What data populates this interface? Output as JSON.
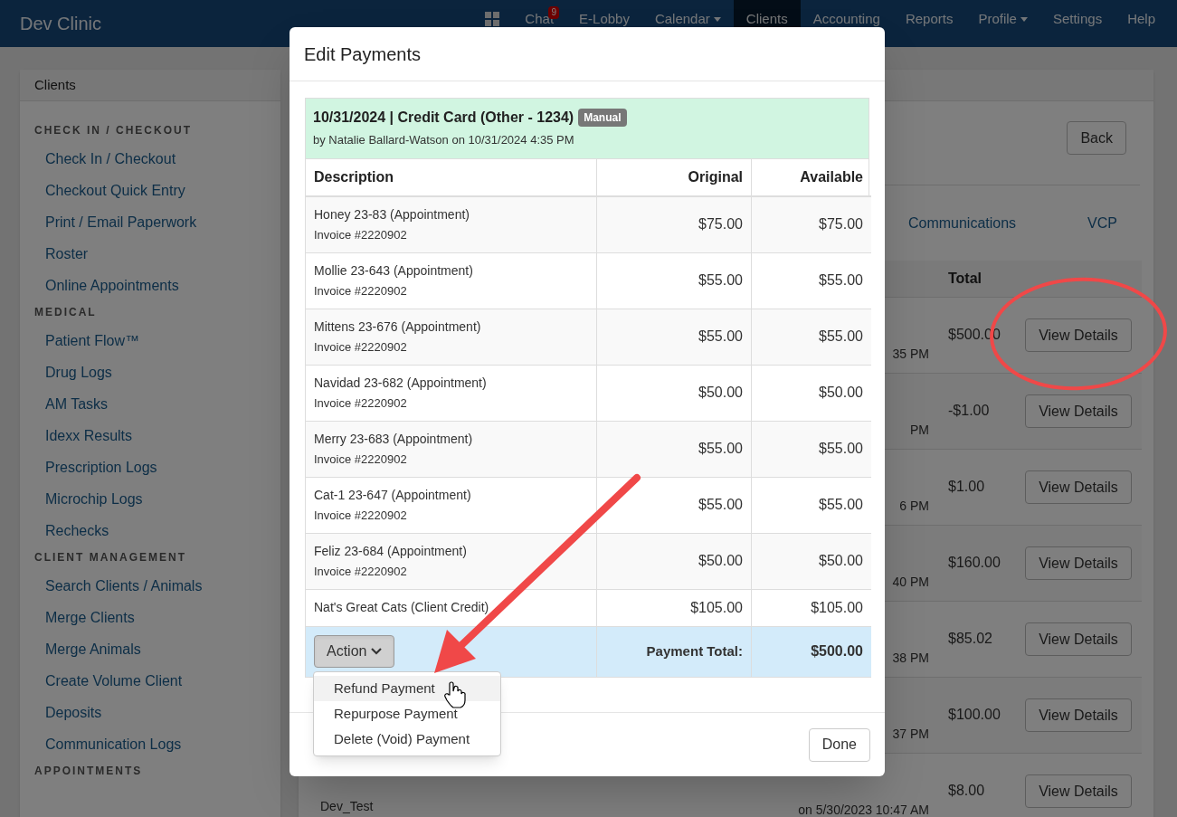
{
  "brand": "Dev Clinic",
  "nav": [
    {
      "kind": "grid",
      "selected": false
    },
    {
      "kind": "link",
      "label": "Chat",
      "badge": "9",
      "selected": false
    },
    {
      "kind": "link",
      "label": "E-Lobby",
      "selected": false
    },
    {
      "kind": "dropdown",
      "label": "Calendar",
      "selected": false
    },
    {
      "kind": "link",
      "label": "Clients",
      "selected": true
    },
    {
      "kind": "link",
      "label": "Accounting",
      "selected": false
    },
    {
      "kind": "link",
      "label": "Reports",
      "selected": false
    },
    {
      "kind": "dropdown",
      "label": "Profile",
      "selected": false
    },
    {
      "kind": "link",
      "label": "Settings",
      "selected": false
    },
    {
      "kind": "link",
      "label": "Help",
      "selected": false
    }
  ],
  "sidebar": {
    "title": "Clients",
    "sections": [
      {
        "heading": "CHECK IN / CHECKOUT",
        "items": [
          "Check In / Checkout",
          "Checkout Quick Entry",
          "Print / Email Paperwork",
          "Roster",
          "Online Appointments"
        ]
      },
      {
        "heading": "MEDICAL",
        "items": [
          "Patient Flow™",
          "Drug Logs",
          "AM Tasks",
          "Idexx Results",
          "Prescription Logs",
          "Microchip Logs",
          "Rechecks"
        ]
      },
      {
        "heading": "CLIENT MANAGEMENT",
        "items": [
          "Search Clients / Animals",
          "Merge Clients",
          "Merge Animals",
          "Create Volume Client",
          "Deposits",
          "Communication Logs"
        ]
      },
      {
        "heading": "APPOINTMENTS"
      }
    ]
  },
  "main": {
    "back_button": "Back",
    "tabs": [
      "Communications",
      "VCP"
    ],
    "total_column": "Total",
    "rows": [
      {
        "time": "35 PM",
        "total": "$500.00",
        "button": "View Details"
      },
      {
        "time": "PM",
        "total": "-$1.00",
        "button": "View Details"
      },
      {
        "time": "6 PM",
        "total": "$1.00",
        "button": "View Details"
      },
      {
        "time": "40 PM",
        "total": "$160.00",
        "button": "View Details"
      },
      {
        "time": "38 PM",
        "total": "$85.02",
        "button": "View Details"
      },
      {
        "time": "37 PM",
        "total": "$100.00",
        "button": "View Details"
      },
      {
        "name": "Dev_Test",
        "time": "on 5/30/2023 10:47 AM",
        "total": "$8.00",
        "button": "View Details"
      }
    ]
  },
  "modal": {
    "title": "Edit Payments",
    "payment": {
      "heading": "10/31/2024 | Credit Card (Other - 1234)",
      "badge": "Manual",
      "byline": "by Natalie Ballard-Watson on 10/31/2024 4:35 PM"
    },
    "columns": [
      "Description",
      "Original",
      "Available"
    ],
    "rows": [
      {
        "description": "Honey 23-83 (Appointment)",
        "invoice": "Invoice #2220902",
        "original": "$75.00",
        "available": "$75.00"
      },
      {
        "description": "Mollie 23-643 (Appointment)",
        "invoice": "Invoice #2220902",
        "original": "$55.00",
        "available": "$55.00"
      },
      {
        "description": "Mittens 23-676 (Appointment)",
        "invoice": "Invoice #2220902",
        "original": "$55.00",
        "available": "$55.00"
      },
      {
        "description": "Navidad 23-682 (Appointment)",
        "invoice": "Invoice #2220902",
        "original": "$50.00",
        "available": "$50.00"
      },
      {
        "description": "Merry 23-683 (Appointment)",
        "invoice": "Invoice #2220902",
        "original": "$55.00",
        "available": "$55.00"
      },
      {
        "description": "Cat-1 23-647 (Appointment)",
        "invoice": "Invoice #2220902",
        "original": "$55.00",
        "available": "$55.00"
      },
      {
        "description": "Feliz 23-684 (Appointment)",
        "invoice": "Invoice #2220902",
        "original": "$50.00",
        "available": "$50.00"
      },
      {
        "description": "Nat's Great Cats (Client Credit)",
        "original": "$105.00",
        "available": "$105.00"
      }
    ],
    "action_button": "Action",
    "total_label": "Payment Total:",
    "total": "$500.00",
    "action_menu": {
      "expanded": true,
      "items": [
        {
          "label": "Refund Payment",
          "selected": true
        },
        {
          "label": "Repurpose Payment",
          "selected": false
        },
        {
          "label": "Delete (Void) Payment",
          "selected": false
        }
      ]
    },
    "done_button": "Done"
  }
}
